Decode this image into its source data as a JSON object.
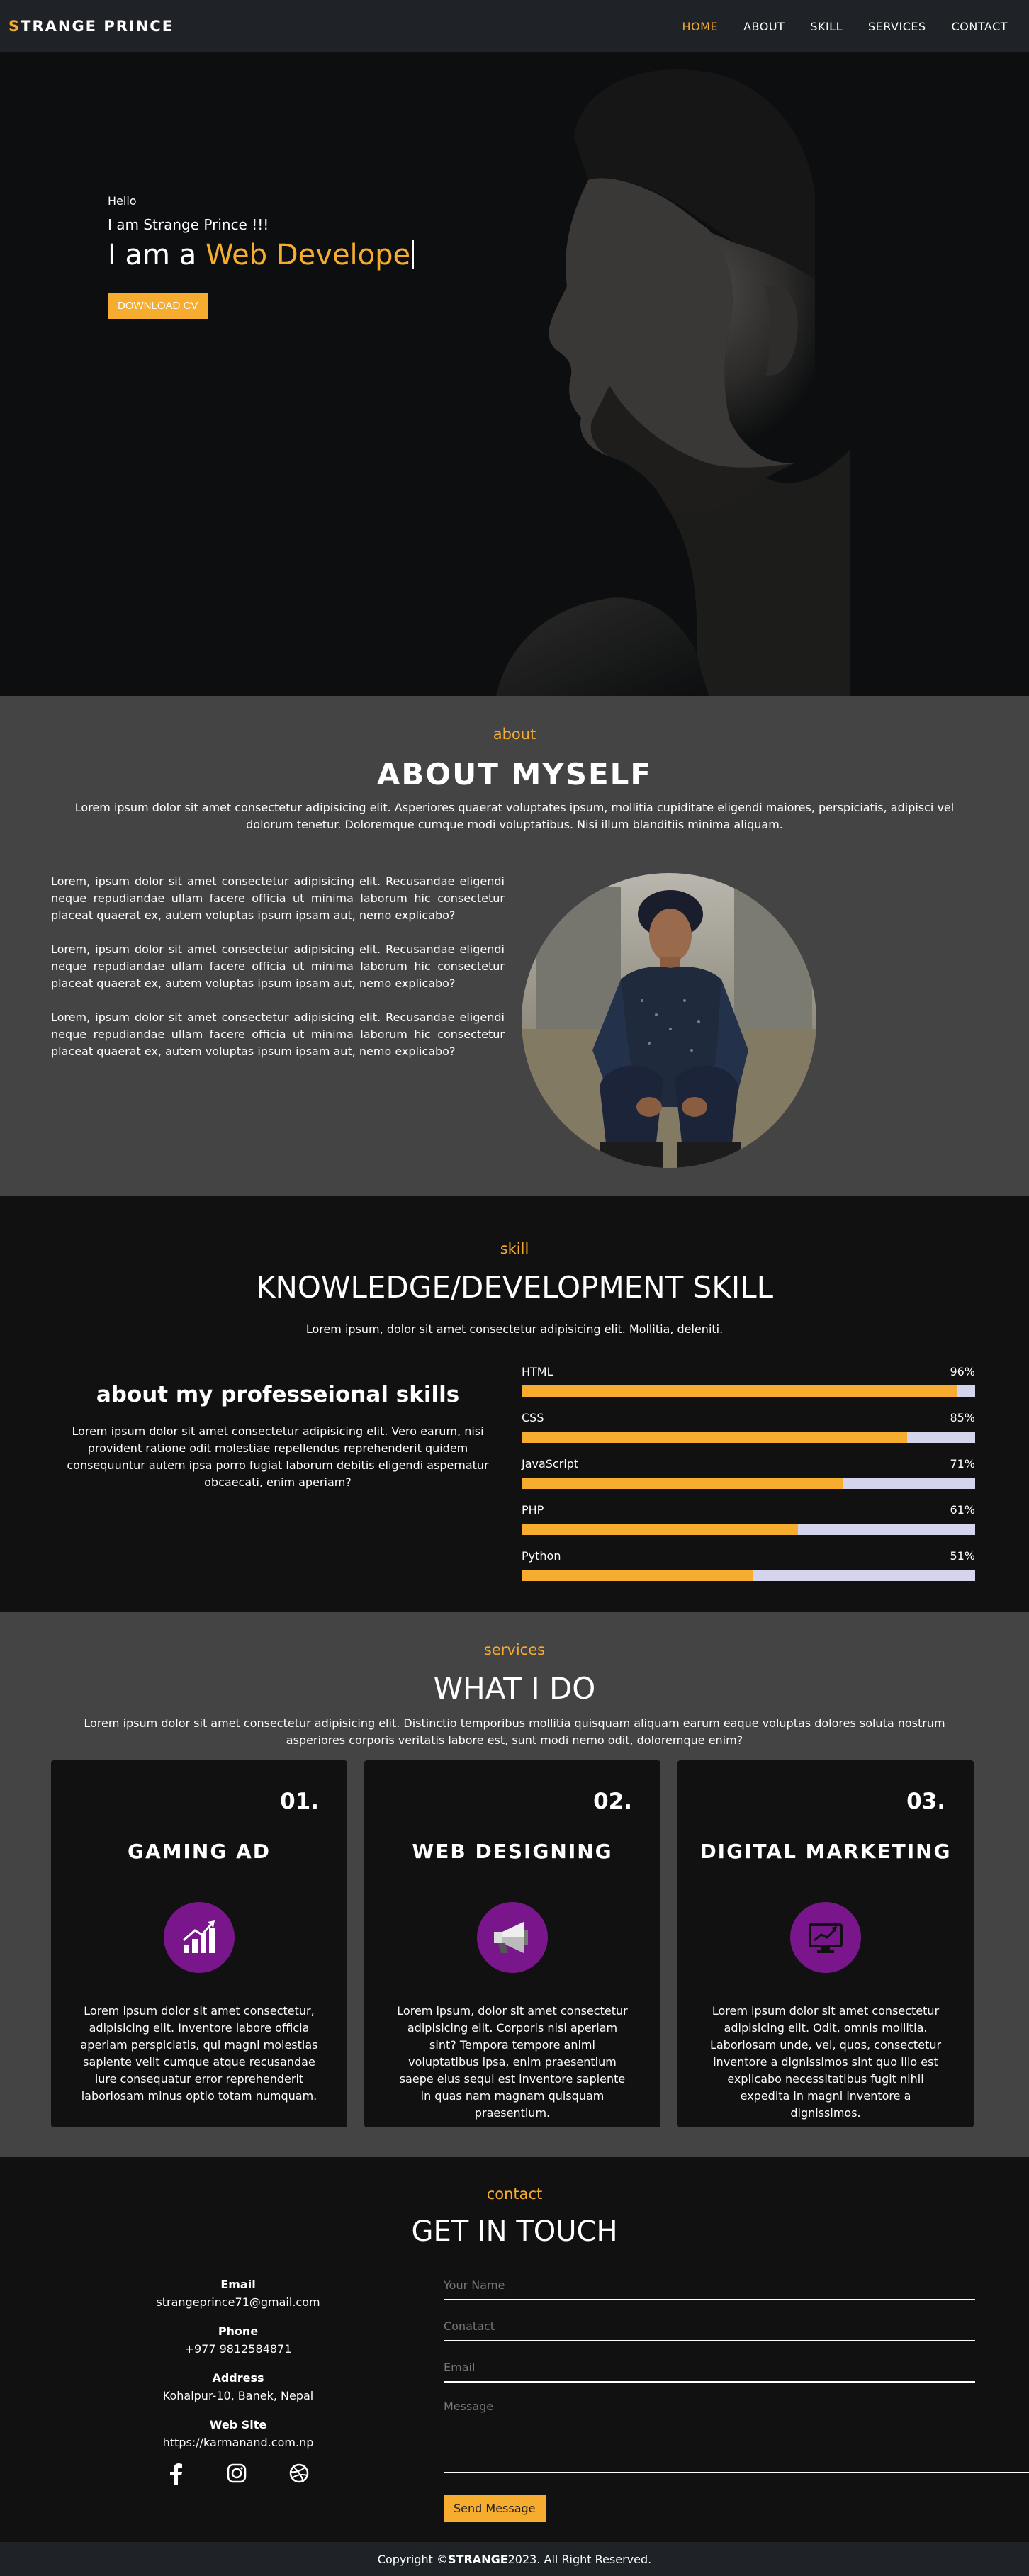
{
  "nav": {
    "logo_first": "S",
    "logo_rest": "TRANGE PRINCE",
    "items": [
      "HOME",
      "ABOUT",
      "SKILL",
      "SERVICES",
      "CONTACT"
    ],
    "active": "HOME"
  },
  "hero": {
    "hello": "Hello",
    "intro": "I am Strange Prince !!!",
    "headline_prefix": "I am a ",
    "headline_role": "Web Develope",
    "cta": "DOWNLOAD CV"
  },
  "about": {
    "tag": "about",
    "title": "ABOUT MYSELF",
    "desc": "Lorem ipsum dolor sit amet consectetur adipisicing elit. Asperiores quaerat voluptates ipsum, mollitia cupiditate eligendi maiores, perspiciatis, adipisci vel dolorum tenetur. Doloremque cumque modi voluptatibus. Nisi illum blanditiis minima aliquam.",
    "paragraphs": [
      "Lorem, ipsum dolor sit amet consectetur adipisicing elit. Recusandae eligendi neque repudiandae ullam facere officia ut minima laborum hic consectetur placeat quaerat ex, autem voluptas ipsum ipsam aut, nemo explicabo?",
      "Lorem, ipsum dolor sit amet consectetur adipisicing elit. Recusandae eligendi neque repudiandae ullam facere officia ut minima laborum hic consectetur placeat quaerat ex, autem voluptas ipsum ipsam aut, nemo explicabo?",
      "Lorem, ipsum dolor sit amet consectetur adipisicing elit. Recusandae eligendi neque repudiandae ullam facere officia ut minima laborum hic consectetur placeat quaerat ex, autem voluptas ipsum ipsam aut, nemo explicabo?"
    ]
  },
  "skill": {
    "tag": "skill",
    "title": "KNOWLEDGE/DEVELOPMENT SKILL",
    "desc": "Lorem ipsum, dolor sit amet consectetur adipisicing elit. Mollitia, deleniti.",
    "left_title": "about my professeional skills",
    "left_text": "Lorem ipsum dolor sit amet consectetur adipisicing elit. Vero earum, nisi provident ratione odit molestiae repellendus reprehenderit quidem consequuntur autem ipsa porro fugiat laborum debitis eligendi aspernatur obcaecati, enim aperiam?",
    "bars": [
      {
        "name": "HTML",
        "label": "96%",
        "value": 96
      },
      {
        "name": "CSS",
        "label": "85%",
        "value": 85
      },
      {
        "name": "JavaScript",
        "label": "71%",
        "value": 71
      },
      {
        "name": "PHP",
        "label": "61%",
        "value": 61
      },
      {
        "name": "Python",
        "label": "51%",
        "value": 51
      }
    ],
    "colors": {
      "fill": "#f5ac2f",
      "track": "#d4d4ec"
    }
  },
  "services": {
    "tag": "services",
    "title": "WHAT I DO",
    "desc": "Lorem ipsum dolor sit amet consectetur adipisicing elit. Distinctio temporibus mollitia quisquam aliquam earum eaque voluptas dolores soluta nostrum asperiores corporis veritatis labore est, sunt modi nemo odit, doloremque enim?",
    "cards": [
      {
        "num": "01.",
        "title": "GAMING AD",
        "icon": "chart-growth-icon",
        "text": "Lorem ipsum dolor sit amet consectetur, adipisicing elit. Inventore labore officia aperiam perspiciatis, qui magni molestias sapiente velit cumque atque recusandae iure consequatur error reprehenderit laboriosam minus optio totam numquam."
      },
      {
        "num": "02.",
        "title": "WEB DESIGNING",
        "icon": "megaphone-icon",
        "text": "Lorem ipsum, dolor sit amet consectetur adipisicing elit. Corporis nisi aperiam sint? Tempora tempore animi voluptatibus ipsa, enim praesentium saepe eius sequi est inventore sapiente in quas nam magnam quisquam praesentium."
      },
      {
        "num": "03.",
        "title": "DIGITAL MARKETING",
        "icon": "monitor-trend-icon",
        "text": "Lorem ipsum dolor sit amet consectetur adipisicing elit. Odit, omnis mollitia. Laboriosam unde, vel, quos, consectetur inventore a dignissimos sint quo illo est explicabo necessitatibus fugit nihil expedita in magni inventore a dignissimos."
      }
    ]
  },
  "contact": {
    "tag": "contact",
    "title": "GET IN TOUCH",
    "info": [
      {
        "label": "Email",
        "value": "strangeprince71@gmail.com"
      },
      {
        "label": "Phone",
        "value": "+977 9812584871"
      },
      {
        "label": "Address",
        "value": "Kohalpur-10, Banek, Nepal"
      },
      {
        "label": "Web Site",
        "value": "https://karmanand.com.np"
      }
    ],
    "socials": [
      "facebook-icon",
      "instagram-icon",
      "dribbble-icon"
    ],
    "form": {
      "name_placeholder": "Your Name",
      "contact_placeholder": "Conatact",
      "email_placeholder": "Email",
      "message_placeholder": "Message",
      "submit": "Send Message"
    }
  },
  "footer": {
    "prefix": "Copyright © ",
    "brand": "STRANGE",
    "suffix": " 2023. All Right Reserved."
  },
  "theme": {
    "accent": "#f5ac2f",
    "dark": "#111111",
    "gray": "#444444",
    "nav": "#1f2226",
    "icon_bg": "#7a168c"
  }
}
